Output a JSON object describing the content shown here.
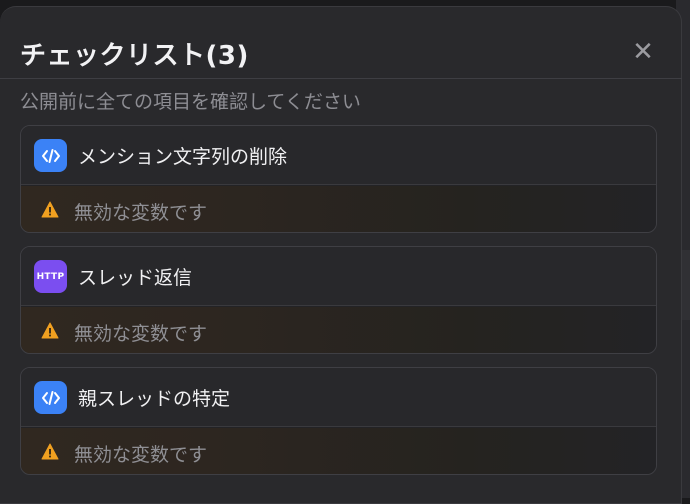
{
  "dialog": {
    "title": "チェックリスト(3)",
    "close_icon": "✕",
    "subtitle": "公開前に全ての項目を確認してください"
  },
  "items": [
    {
      "icon": "code-icon",
      "icon_text": "",
      "title": "メンション文字列の削除",
      "warning": "無効な変数です"
    },
    {
      "icon": "http-icon",
      "icon_text": "HTTP",
      "title": "スレッド返信",
      "warning": "無効な変数です"
    },
    {
      "icon": "code-icon",
      "icon_text": "",
      "title": "親スレッドの特定",
      "warning": "無効な変数です"
    }
  ],
  "colors": {
    "code_icon_bg": "#3b82f6",
    "http_icon_bg": "#7b4ef0",
    "warning_color": "#f0a020"
  }
}
